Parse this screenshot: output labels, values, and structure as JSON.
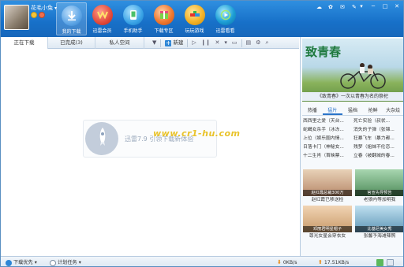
{
  "header": {
    "username": "花毛小兔",
    "nav": [
      {
        "label": "我的下载",
        "icon": "download-icon",
        "color": "#5fa6e6",
        "active": true
      },
      {
        "label": "迅雷会员",
        "icon": "vip-icon",
        "color": "#e24a3a"
      },
      {
        "label": "手机助手",
        "icon": "phone-icon",
        "color": "#3aa3e6"
      },
      {
        "label": "下载专区",
        "icon": "box-icon",
        "color": "#f07a30"
      },
      {
        "label": "玩玩游戏",
        "icon": "game-icon",
        "color": "#f3b328"
      },
      {
        "label": "迅雷看看",
        "icon": "play-icon",
        "color": "#1d9fd6"
      }
    ]
  },
  "tabs": [
    {
      "label": "正在下载",
      "active": true
    },
    {
      "label": "已完成(3)"
    },
    {
      "label": "私人空间"
    }
  ],
  "toolbar": {
    "new_label": "新建"
  },
  "main": {
    "watermark_text": "迅雷7.9 引领下载新体验",
    "watermark_url": "www.cr1-hu.com"
  },
  "right_panel": {
    "banner_title": "致青春",
    "banner_caption": "《致青春》一次以青春为名的祭祀",
    "tabs": [
      "热播",
      "猛片",
      "猛档",
      "抢鲜",
      "大杂烩"
    ],
    "active_tab": 1,
    "news": [
      [
        "西西里之爱（天台...",
        "死亡实验（叔状..."
      ],
      [
        "蛇蝎女杀手（冰冻...",
        "消失的子弹（张锦..."
      ],
      [
        "上位（娱乐圈内情...",
        "狂暴飞车（暴力都..."
      ],
      [
        "日落卡门（神秘女...",
        "残梦（姐妹不伦恋..."
      ],
      [
        "十二生肖（首映票...",
        "立春（被翻城的春..."
      ]
    ],
    "thumbs": [
      {
        "caption": "赵红霞总裁300万",
        "label": "赵红霞已移送检",
        "bg": "#c9a88a"
      },
      {
        "caption": "官宣先导预告",
        "label": "老狼内等加明我",
        "bg": "#6fa377"
      },
      {
        "caption": "邓丽君明星帽子",
        "label": "尊光女星会穿衣女",
        "bg": "#d8b48c"
      },
      {
        "caption": "比基尼美女秀",
        "label": "张馨予海滩辣照",
        "bg": "#86b2c9"
      }
    ]
  },
  "statusbar": {
    "priority_label": "下载优先",
    "schedule_label": "计划任务",
    "down_speed": "0KB/s",
    "up_speed": "17.51KB/s"
  }
}
